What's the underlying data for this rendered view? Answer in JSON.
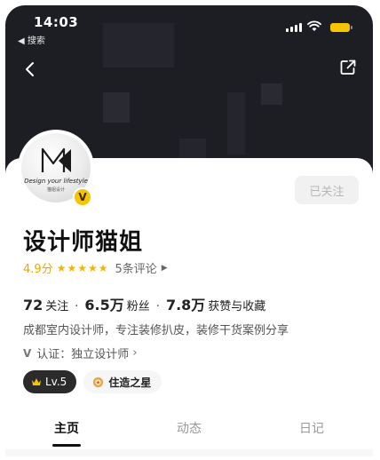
{
  "status_bar": {
    "time": "14:03",
    "back_label": "◀ 搜索"
  },
  "profile": {
    "avatar_logo_text": "Design your lifestyle",
    "avatar_logo_sub": "猫姐设计",
    "verified_badge": "V",
    "follow_button": "已关注",
    "name": "设计师猫姐",
    "rating": "4.9分",
    "stars": 5,
    "reviews": "5条评论",
    "stats": {
      "following_count": "72",
      "following_label": "关注",
      "fans_count": "6.5万",
      "fans_label": "粉丝",
      "likes_count": "7.8万",
      "likes_label": "获赞与收藏"
    },
    "bio": "成都室内设计师，专注装修扒皮，装修干货案例分享",
    "certification": "认证：独立设计师",
    "level_badge": "Lv.5",
    "star_badge": "住造之星"
  },
  "tabs": [
    {
      "label": "主页",
      "active": true
    },
    {
      "label": "动态",
      "active": false
    },
    {
      "label": "日记",
      "active": false
    }
  ],
  "colors": {
    "header_bg": "#1d1d24",
    "accent_yellow": "#f7c400",
    "rating_orange": "#f0a800"
  }
}
